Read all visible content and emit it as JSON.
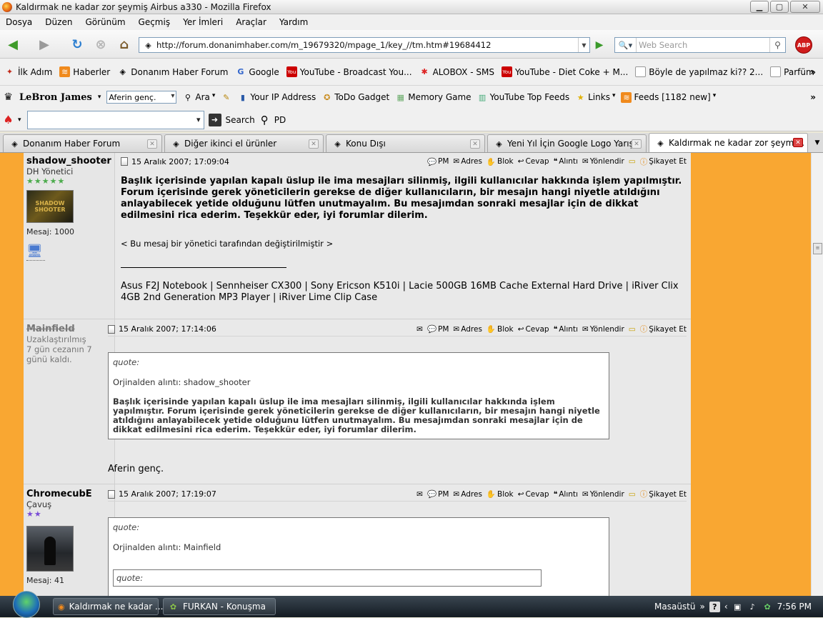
{
  "window": {
    "title": "Kaldırmak ne kadar zor şeymiş Airbus a330 - Mozilla Firefox"
  },
  "menu": [
    "Dosya",
    "Düzen",
    "Görünüm",
    "Geçmiş",
    "Yer İmleri",
    "Araçlar",
    "Yardım"
  ],
  "nav": {
    "url": "http://forum.donanimhaber.com/m_19679320/mpage_1/key_//tm.htm#19684412",
    "search_placeholder": "Web Search",
    "abp": "ABP"
  },
  "bookmarks": [
    "İlk Adım",
    "Haberler",
    "Donanım Haber Forum",
    "Google",
    "YouTube - Broadcast You...",
    "ALOBOX - SMS",
    "YouTube - Diet Coke + M...",
    "Böyle de yapılmaz ki?? 2...",
    "Parfüm"
  ],
  "toolbar2": {
    "user": "LeBron James",
    "select_value": "Aferin genç.",
    "items": [
      "Ara",
      "Your IP Address",
      "ToDo Gadget",
      "Memory Game",
      "YouTube Top Feeds",
      "Links",
      "Feeds [1182 new]"
    ]
  },
  "toolbar3": {
    "search": "Search",
    "pd": "PD"
  },
  "tabs": [
    "Donanım Haber Forum",
    "Diğer ikinci el ürünler",
    "Konu Dışı",
    "Yeni Yıl İçin Google Logo Yarış...",
    "Kaldırmak ne kadar zor şeymi..."
  ],
  "actions": {
    "pm": "PM",
    "adres": "Adres",
    "blok": "Blok",
    "cevap": "Cevap",
    "alinti": "Alıntı",
    "yonlendir": "Yönlendir",
    "sikayet": "Şikayet Et"
  },
  "posts": [
    {
      "user": "shadow_shooter",
      "rank": "DH Yönetici",
      "stars": "★★★★★",
      "avatar_text": "SHADOW SHOOTER",
      "count": "Mesaj: 1000",
      "date": "15 Aralık 2007; 17:09:04",
      "body": "Başlık içerisinde yapılan kapalı üslup ile ima mesajları silinmiş, ilgili kullanıcılar hakkında işlem yapılmıştır. Forum içerisinde gerek yöneticilerin gerekse de diğer kullanıcıların, bir mesajın hangi niyetle atıldığını anlayabilecek yetide olduğunu lütfen unutmayalım. Bu mesajımdan sonraki mesajlar için de dikkat edilmesini rica ederim. Teşekkür eder, iyi forumlar dilerim.",
      "edited": "< Bu mesaj bir yönetici tarafından değiştirilmiştir >",
      "signature": "Asus F2J Notebook | Sennheiser CX300 | Sony Ericson K510i | Lacie 500GB 16MB Cache External Hard Drive | iRiver Clix 4GB 2nd Generation MP3 Player | iRiver Lime Clip Case"
    },
    {
      "user": "Mainfield",
      "rank": "Uzaklaştırılmış",
      "ban": "7 gün cezanın 7 günü kaldı.",
      "date": "15 Aralık 2007; 17:14:06",
      "quote_title": "quote:",
      "quote_author": "Orjinalden alıntı: shadow_shooter",
      "quote_body": "Başlık içerisinde yapılan kapalı üslup ile ima mesajları silinmiş, ilgili kullanıcılar hakkında işlem yapılmıştır. Forum içerisinde gerek yöneticilerin gerekse de diğer kullanıcıların, bir mesajın hangi niyetle atıldığını anlayabilecek yetide olduğunu lütfen unutmayalım. Bu mesajımdan sonraki mesajlar için de dikkat edilmesini rica ederim. Teşekkür eder, iyi forumlar dilerim.",
      "body": "Aferin genç."
    },
    {
      "user": "ChromecubE",
      "rank": "Çavuş",
      "stars": "★★",
      "count": "Mesaj: 41",
      "date": "15 Aralık 2007; 17:19:07",
      "quote_title": "quote:",
      "quote_author": "Orjinalden alıntı: Mainfield",
      "inner_quote_title": "quote:"
    }
  ],
  "taskbar": {
    "items": [
      "Kaldırmak ne kadar ...",
      "FURKAN - Konuşma"
    ],
    "desktop": "Masaüstü",
    "time": "7:56 PM"
  }
}
